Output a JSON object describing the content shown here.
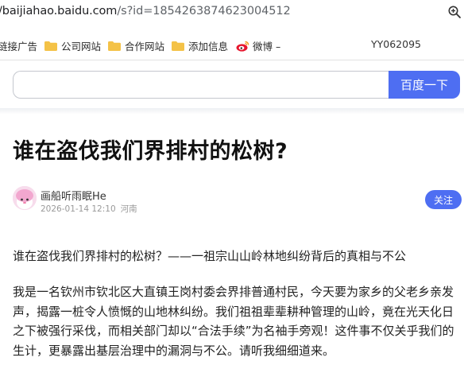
{
  "browser": {
    "url_host": "/baijiahao.baidu.com",
    "url_path": "/s?id=1854263874623004512"
  },
  "bookmarks": {
    "items": [
      {
        "label": "链接广告",
        "icon": "folder-icon"
      },
      {
        "label": "公司网站",
        "icon": "folder-icon"
      },
      {
        "label": "合作网站",
        "icon": "folder-icon"
      },
      {
        "label": "添加信息",
        "icon": "folder-icon"
      },
      {
        "label": "微博 –",
        "icon": "weibo-icon"
      }
    ],
    "right_text": "YY062095"
  },
  "search": {
    "placeholder": "",
    "button_label": "百度一下"
  },
  "article": {
    "title": "谁在盗伐我们界排村的松树?",
    "author": "画船听雨眠He",
    "date": "2026-01-14 12:10",
    "location": "河南",
    "follow_label": "关注",
    "paragraph1": "谁在盗伐我们界排村的松树？——一祖宗山山岭林地纠纷背后的真相与不公",
    "paragraph2": "我是一名钦州市钦北区大直镇王岗村委会界排普通村民，今天要为家乡的父老乡亲发声，揭露一桩令人愤慨的山地林纠纷。我们祖祖辈辈耕种管理的山岭，竟在光天化日之下被强行采伐，而相关部门却以“合法手续”为名袖手旁观！这件事不仅关乎我们的生计，更暴露出基层治理中的漏洞与不公。请听我细细道来。"
  },
  "colors": {
    "accent": "#4e6ef2",
    "folder": "#f4c247"
  }
}
